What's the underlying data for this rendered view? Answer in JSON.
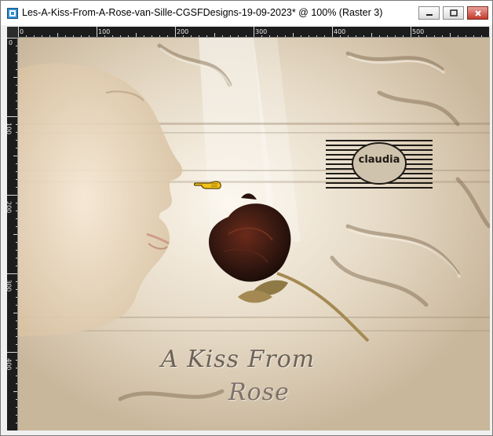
{
  "window": {
    "title": "Les-A-Kiss-From-A-Rose-van-Sille-CGSFDesigns-19-09-2023* @ 100% (Raster 3)",
    "controls": [
      "minimize",
      "maximize",
      "close"
    ]
  },
  "ruler_top": {
    "labels": [
      "0",
      "100",
      "200",
      "300",
      "400",
      "500"
    ]
  },
  "ruler_left": {
    "labels": [
      "0",
      "100",
      "200",
      "300",
      "400"
    ]
  },
  "canvas": {
    "caption_line1": "A Kiss From",
    "caption_line2": "Rose",
    "watermark": "claudia"
  },
  "colors": {
    "title_bar": "#ffffff",
    "close_button": "#c4392c",
    "ruler_bg": "#1c1c1c",
    "canvas_tone": "#e2d6c3",
    "rose": "#3a1a12"
  },
  "icons": [
    "app-icon",
    "minimize-icon",
    "maximize-icon",
    "close-icon",
    "pointer-hand-icon"
  ]
}
